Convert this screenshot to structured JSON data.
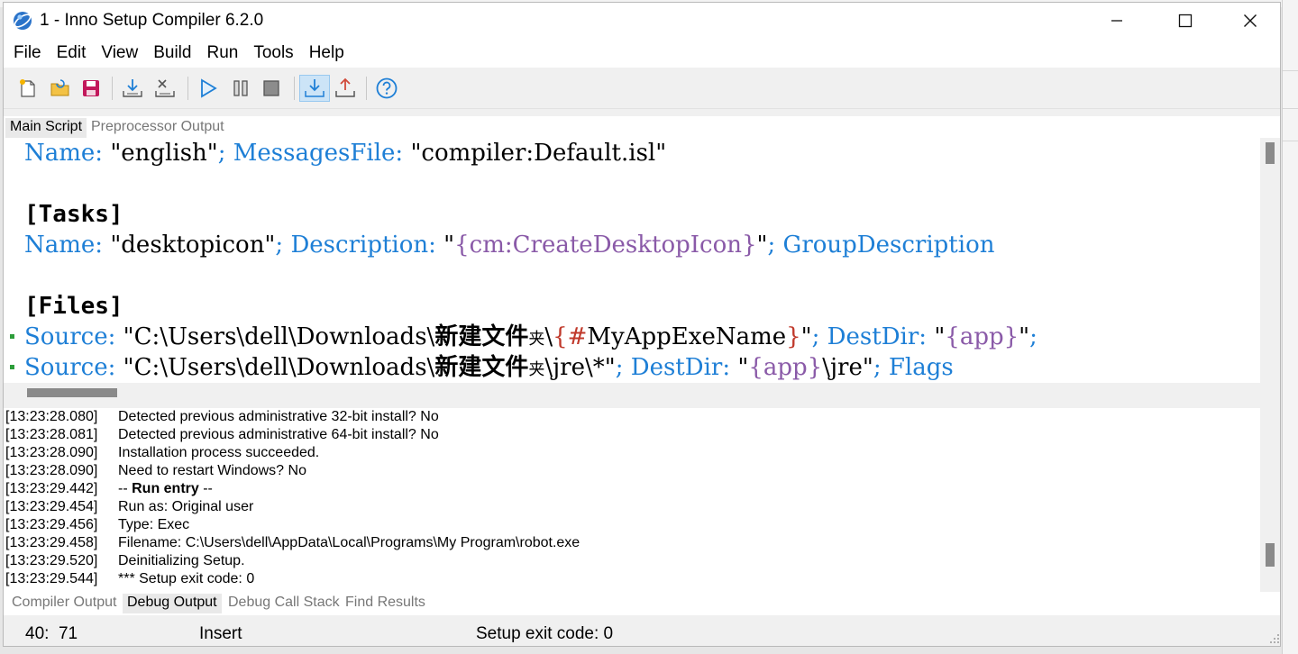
{
  "window": {
    "title": "1 - Inno Setup Compiler 6.2.0"
  },
  "menu": [
    "File",
    "Edit",
    "View",
    "Build",
    "Run",
    "Tools",
    "Help"
  ],
  "toolbar": {
    "icons": [
      "new-file-icon",
      "open-folder-icon",
      "save-icon",
      "compile-icon",
      "stop-compile-icon",
      "run-icon",
      "pause-icon",
      "stop-icon",
      "target-setup-icon",
      "target-uninstall-icon",
      "help-icon"
    ]
  },
  "top_tabs": [
    "Main Script",
    "Preprocessor Output"
  ],
  "editor": {
    "line1": {
      "k1": "Name",
      "p1": ":",
      "v1": " \"english\"",
      "s1": ";",
      "k2": "MessagesFile",
      "p2": ":",
      "v2": " \"compiler:Default.isl\""
    },
    "tasks_header": "[Tasks]",
    "line2": {
      "k1": "Name",
      "p1": ":",
      "v1": " \"desktopicon\"",
      "s1": ";",
      "k2": "Description",
      "p2": ":",
      "q1": " \"",
      "c1": "{cm:CreateDesktopIcon}",
      "q2": "\"",
      "s2": ";",
      "k3": "GroupDescription"
    },
    "files_header": "[Files]",
    "line3": {
      "k1": "Source",
      "p1": ":",
      "v1a": " \"C:\\Users\\dell\\Downloads\\",
      "cjk": "新建文件",
      "cjk_small": "夹",
      "v1b": "\\",
      "pp_open": "{#",
      "pp_name": "MyAppExeName",
      "pp_close": "}",
      "q": "\"",
      "s1": ";",
      "k2": "DestDir",
      "p2": ":",
      "q3": " \"",
      "c1": "{app}",
      "q4": "\"",
      "s2": ";"
    },
    "line4": {
      "k1": "Source",
      "p1": ":",
      "v1a": " \"C:\\Users\\dell\\Downloads\\",
      "cjk": "新建文件",
      "cjk_small": "夹",
      "v1b": "\\jre\\*\"",
      "s1": ";",
      "k2": "DestDir",
      "p2": ":",
      "q1": " \"",
      "c1": "{app}",
      "v2": "\\jre\"",
      "s2": ";",
      "k3": "Flags"
    }
  },
  "log": [
    {
      "ts": "[13:23:28.080]",
      "msg": "Detected previous administrative 32-bit install? No"
    },
    {
      "ts": "[13:23:28.081]",
      "msg": "Detected previous administrative 64-bit install? No"
    },
    {
      "ts": "[13:23:28.090]",
      "msg": "Installation process succeeded."
    },
    {
      "ts": "[13:23:28.090]",
      "msg": "Need to restart Windows? No"
    },
    {
      "ts": "[13:23:29.442]",
      "msg_pre": "-- ",
      "msg_bold": "Run entry",
      "msg_post": " --"
    },
    {
      "ts": "[13:23:29.454]",
      "msg": "Run as: Original user"
    },
    {
      "ts": "[13:23:29.456]",
      "msg": "Type: Exec"
    },
    {
      "ts": "[13:23:29.458]",
      "msg": "Filename: C:\\Users\\dell\\AppData\\Local\\Programs\\My Program\\robot.exe"
    },
    {
      "ts": "[13:23:29.520]",
      "msg": "Deinitializing Setup."
    },
    {
      "ts": "[13:23:29.544]",
      "msg": "*** Setup exit code: 0"
    }
  ],
  "bottom_tabs": [
    "Compiler Output",
    "Debug Output",
    "Debug Call Stack",
    "Find Results"
  ],
  "status": {
    "position": "40:  71",
    "mode": "Insert",
    "message": "Setup exit code: 0"
  }
}
